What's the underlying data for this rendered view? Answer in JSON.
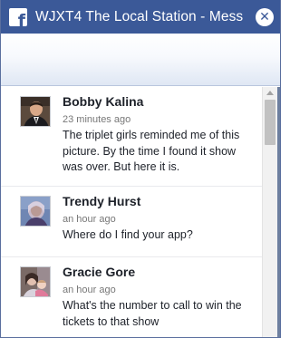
{
  "window": {
    "title": "WJXT4 The Local Station - Mess",
    "logo_letter": "f",
    "close_glyph": "✕"
  },
  "comments": [
    {
      "name": "Bobby Kalina",
      "time": "23 minutes ago",
      "text": "The triplet girls reminded me of this picture. By the time I found it show was over. But here it is.",
      "avatar": "avatar-man-in-suit"
    },
    {
      "name": "Trendy Hurst",
      "time": "an hour ago",
      "text": "Where do I find your app?",
      "avatar": "avatar-woman-portrait"
    },
    {
      "name": "Gracie Gore",
      "time": "an hour ago",
      "text": "What's the number to call to win the tickets to that show",
      "avatar": "avatar-woman-with-child"
    }
  ],
  "colors": {
    "brand": "#3b5998",
    "text": "#1d2129",
    "meta": "#777777"
  }
}
